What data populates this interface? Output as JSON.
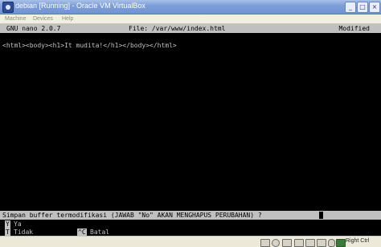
{
  "window": {
    "title": "debian [Running] - Oracle VM VirtualBox",
    "buttons": {
      "minimize": "_",
      "maximize": "□",
      "close": "×"
    }
  },
  "menu": {
    "items": [
      "Machine",
      "Devices",
      "Help"
    ]
  },
  "nano": {
    "version": "GNU nano 2.0.7",
    "file": "File: /var/www/index.html",
    "status": "Modified",
    "content": [
      "<html><body><h1>It mudita!</h1></body></html>"
    ],
    "prompt": "Simpan buffer termodifikasi (JAWAB \"No\" AKAN MENGHAPUS PERUBAHAN) ?",
    "options": [
      {
        "key": "Y",
        "label": "Ya"
      },
      {
        "key": "T",
        "label": "Tidak"
      },
      {
        "key": "^C",
        "label": "Batal"
      }
    ]
  },
  "statusbar": {
    "icons": [
      "hard-disk-icon",
      "cd-icon",
      "usb-icon",
      "shared-folder-icon",
      "network-icon",
      "display-icon",
      "mouse-integration-icon",
      "keyboard-capture-icon"
    ],
    "host_key": "Right Ctrl"
  }
}
